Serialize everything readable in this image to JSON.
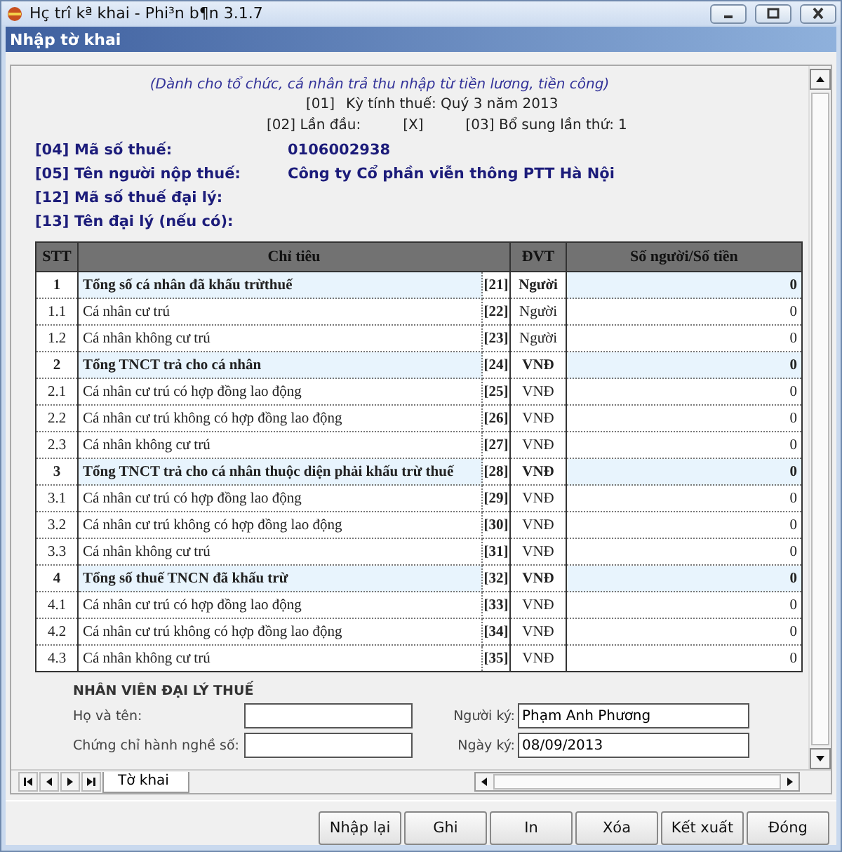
{
  "window": {
    "title": "Hç trî kª khai - Phi³n b¶n 3.1.7"
  },
  "header": {
    "title": "Nhập tờ khai"
  },
  "form": {
    "subtitle": "(Dành cho tổ chức, cá nhân trả thu nhập từ tiền lương, tiền công)",
    "period": {
      "code": "[01]",
      "text": "Kỳ tính thuế: Quý 3 năm 2013"
    },
    "first_time": {
      "code": "[02]",
      "label": "Lần đầu:",
      "value": "[X]"
    },
    "supplement": {
      "code": "[03]",
      "label": "Bổ sung lần thứ:",
      "value": "1"
    },
    "info": [
      {
        "code": "[04]",
        "label": "Mã số thuế:",
        "value": "0106002938"
      },
      {
        "code": "[05]",
        "label": "Tên người nộp thuế:",
        "value": "Công ty Cổ phần viễn thông PTT Hà Nội"
      },
      {
        "code": "[12]",
        "label": "Mã số thuế đại lý:"
      },
      {
        "code": "[13]",
        "label": "Tên đại lý (nếu có):"
      }
    ]
  },
  "table": {
    "columns": [
      "STT",
      "Chỉ tiêu",
      "ĐVT",
      "Số người/Số tiền"
    ],
    "rows": [
      {
        "kind": "group",
        "stt": "1",
        "label": "Tổng số cá nhân đã khấu trừthuế",
        "code": "[21]",
        "unit": "Người",
        "value": "0"
      },
      {
        "kind": "item",
        "stt": "1.1",
        "label": "Cá nhân cư trú",
        "code": "[22]",
        "unit": "Người",
        "value": "0"
      },
      {
        "kind": "item",
        "stt": "1.2",
        "label": "Cá nhân không cư trú",
        "code": "[23]",
        "unit": "Người",
        "value": "0"
      },
      {
        "kind": "group",
        "stt": "2",
        "label": "Tổng TNCT trả cho cá nhân",
        "code": "[24]",
        "unit": "VNĐ",
        "value": "0"
      },
      {
        "kind": "item",
        "stt": "2.1",
        "label": "Cá nhân cư trú có hợp đồng lao động",
        "code": "[25]",
        "unit": "VNĐ",
        "value": "0"
      },
      {
        "kind": "item",
        "stt": "2.2",
        "label": "Cá nhân cư trú không có hợp đồng lao động",
        "code": "[26]",
        "unit": "VNĐ",
        "value": "0"
      },
      {
        "kind": "item",
        "stt": "2.3",
        "label": "Cá nhân không cư trú",
        "code": "[27]",
        "unit": "VNĐ",
        "value": "0"
      },
      {
        "kind": "group",
        "stt": "3",
        "label": "Tổng TNCT trả cho cá nhân thuộc diện phải khấu trừ thuế",
        "code": "[28]",
        "unit": "VNĐ",
        "value": "0"
      },
      {
        "kind": "item",
        "stt": "3.1",
        "label": "Cá nhân cư trú có hợp đồng lao động",
        "code": "[29]",
        "unit": "VNĐ",
        "value": "0"
      },
      {
        "kind": "item",
        "stt": "3.2",
        "label": "Cá nhân cư trú không có hợp đồng lao động",
        "code": "[30]",
        "unit": "VNĐ",
        "value": "0"
      },
      {
        "kind": "item",
        "stt": "3.3",
        "label": "Cá nhân không cư trú",
        "code": "[31]",
        "unit": "VNĐ",
        "value": "0"
      },
      {
        "kind": "group",
        "stt": "4",
        "label": "Tổng số thuế TNCN đã khấu trừ",
        "code": "[32]",
        "unit": "VNĐ",
        "value": "0"
      },
      {
        "kind": "item",
        "stt": "4.1",
        "label": "Cá nhân cư trú có hợp đồng lao động",
        "code": "[33]",
        "unit": "VNĐ",
        "value": "0"
      },
      {
        "kind": "item",
        "stt": "4.2",
        "label": "Cá nhân cư trú không có hợp đồng lao động",
        "code": "[34]",
        "unit": "VNĐ",
        "value": "0"
      },
      {
        "kind": "item",
        "stt": "4.3",
        "label": "Cá nhân không cư trú",
        "code": "[35]",
        "unit": "VNĐ",
        "value": "0"
      }
    ]
  },
  "agent": {
    "title": "NHÂN VIÊN ĐẠI LÝ THUẾ",
    "fields": [
      {
        "label": "Họ và tên:"
      },
      {
        "label": "Người ký:",
        "value": "Phạm Anh Phương"
      },
      {
        "label": "Chứng chỉ hành nghề số:"
      },
      {
        "label": "Ngày ký:",
        "value": "08/09/2013"
      }
    ]
  },
  "sheet_tabs": [
    {
      "label": "Tờ khai",
      "selected": true
    }
  ],
  "buttons": [
    "Nhập lại",
    "Ghi",
    "In",
    "Xóa",
    "Kết xuất",
    "Đóng"
  ]
}
